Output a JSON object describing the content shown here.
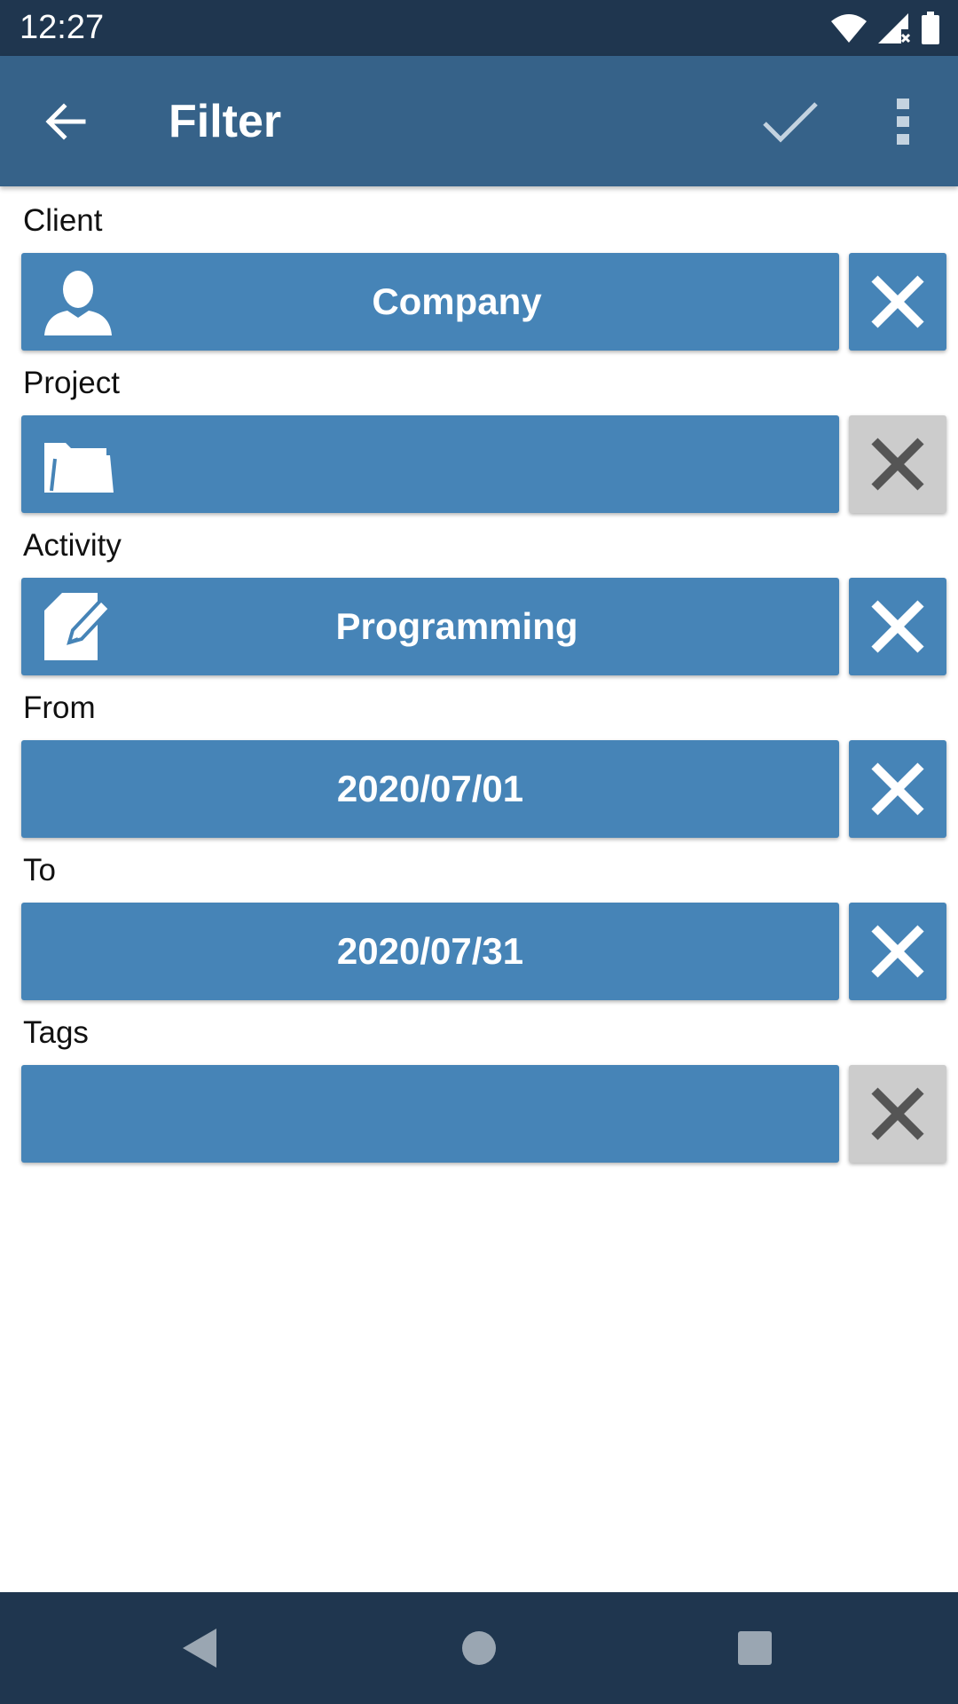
{
  "status_bar": {
    "time": "12:27",
    "icons": [
      "wifi-icon",
      "signal-icon",
      "battery-icon"
    ]
  },
  "app_bar": {
    "title": "Filter",
    "back_icon": "arrow-back-icon",
    "apply_icon": "check-icon",
    "menu_icon": "more-vert-icon"
  },
  "fields": {
    "client": {
      "label": "Client",
      "value": "Company",
      "icon": "person-icon",
      "clear_active": true
    },
    "project": {
      "label": "Project",
      "value": "",
      "icon": "folder-icon",
      "clear_active": false
    },
    "activity": {
      "label": "Activity",
      "value": "Programming",
      "icon": "edit-icon",
      "clear_active": true
    },
    "from": {
      "label": "From",
      "value": "2020/07/01",
      "clear_active": true
    },
    "to": {
      "label": "To",
      "value": "2020/07/31",
      "clear_active": true
    },
    "tags": {
      "label": "Tags",
      "value": "",
      "clear_active": false
    }
  },
  "colors": {
    "status_bar": "#1f364f",
    "app_bar": "#366289",
    "field_button": "#4684b7",
    "clear_inactive": "#cccccc",
    "clear_inactive_icon": "#555555"
  },
  "nav_bar": {
    "icons": [
      "nav-back-icon",
      "nav-home-icon",
      "nav-recents-icon"
    ]
  }
}
